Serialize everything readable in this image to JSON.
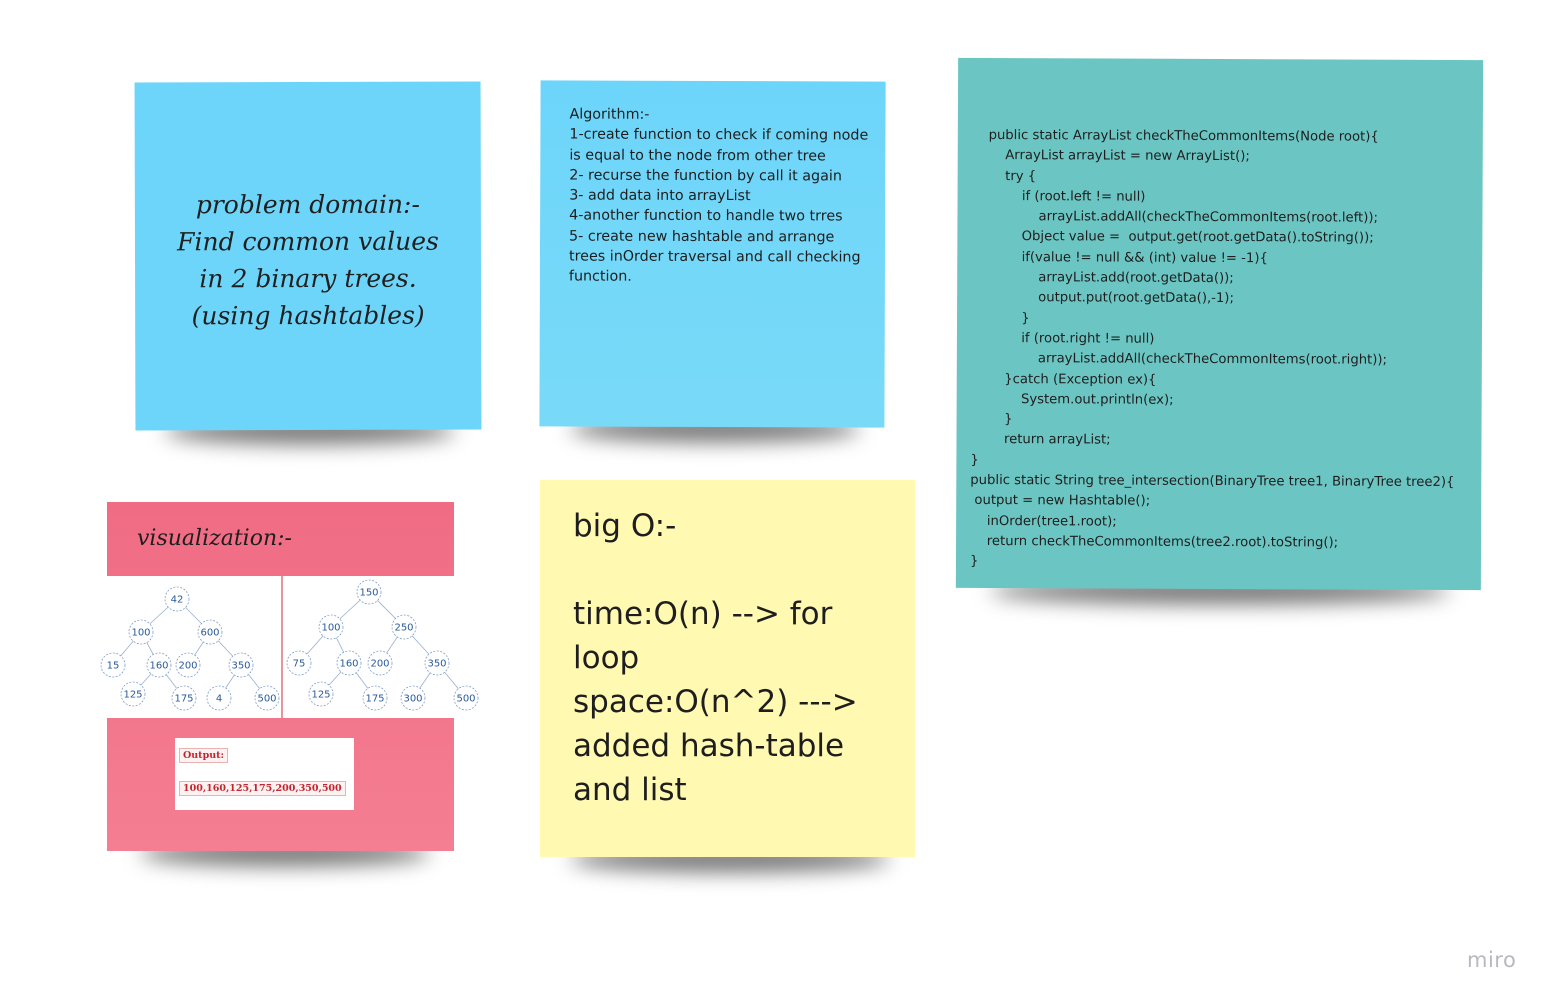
{
  "board": {
    "watermark": "miro"
  },
  "problem_note": {
    "lines": [
      "problem domain:-",
      "Find common values",
      "in 2 binary trees.",
      "(using hashtables)"
    ],
    "color": "#6dd5fa"
  },
  "algorithm_note": {
    "lines": [
      "Algorithm:-",
      "1-create function to check if coming node",
      "is equal to the node from other tree",
      "2- recurse the function by call it again",
      "3- add data into arrayList",
      "4-another function to handle two trres",
      "5- create new hashtable and arrange",
      "trees inOrder traversal and call checking",
      "function."
    ],
    "color": "#6dd5fa"
  },
  "code_note": {
    "lines": [
      "    public static ArrayList checkTheCommonItems(Node root){",
      "        ArrayList arrayList = new ArrayList();",
      "        try {",
      "            if (root.left != null)",
      "                arrayList.addAll(checkTheCommonItems(root.left));",
      "            Object value =  output.get(root.getData().toString());",
      "            if(value != null && (int) value != -1){",
      "                arrayList.add(root.getData());",
      "                output.put(root.getData(),-1);",
      "            }",
      "            if (root.right != null)",
      "                arrayList.addAll(checkTheCommonItems(root.right));",
      "        }catch (Exception ex){",
      "            System.out.println(ex);",
      "        }",
      "        return arrayList;",
      "}",
      "public static String tree_intersection(BinaryTree tree1, BinaryTree tree2){",
      " output = new Hashtable();",
      "    inOrder(tree1.root);",
      "    return checkTheCommonItems(tree2.root).toString();",
      "}"
    ],
    "color": "#6bc6c3"
  },
  "visualization_note": {
    "title": "visualization:-",
    "tree1": [
      "42",
      "100",
      "600",
      "15",
      "160",
      "200",
      "350",
      "125",
      "175",
      "4",
      "500"
    ],
    "tree2": [
      "150",
      "100",
      "250",
      "75",
      "160",
      "200",
      "350",
      "125",
      "175",
      "300",
      "500"
    ],
    "output_label": "Output:",
    "output_value": "100,160,125,175,200,350,500",
    "color": "#f06c84"
  },
  "bigo_note": {
    "lines": [
      "big O:-",
      "",
      "time:O(n) --> for",
      "loop",
      "space:O(n^2) --->",
      "added hash-table",
      "and list"
    ],
    "color": "#fff9b1"
  }
}
